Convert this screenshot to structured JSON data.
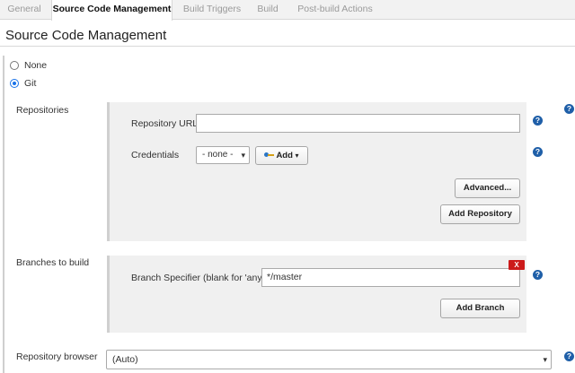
{
  "tabs": [
    {
      "label": "General",
      "active": false
    },
    {
      "label": "Source Code Management",
      "active": true
    },
    {
      "label": "Build Triggers",
      "active": false
    },
    {
      "label": "Build",
      "active": false
    },
    {
      "label": "Post-build Actions",
      "active": false
    }
  ],
  "section": {
    "title": "Source Code Management"
  },
  "scm_options": [
    {
      "label": "None",
      "selected": false
    },
    {
      "label": "Git",
      "selected": true
    }
  ],
  "repositories": {
    "label": "Repositories",
    "url_label": "Repository URL",
    "url_value": "",
    "credentials_label": "Credentials",
    "credentials_value": "- none -",
    "add_label": "Add",
    "advanced_label": "Advanced...",
    "add_repository_label": "Add Repository"
  },
  "branches": {
    "label": "Branches to build",
    "delete_label": "X",
    "specifier_label": "Branch Specifier (blank for 'any')",
    "specifier_value": "*/master",
    "add_branch_label": "Add Branch"
  },
  "repository_browser": {
    "label": "Repository browser",
    "value": "(Auto)"
  },
  "help_glyph": "?",
  "icons": [
    "key-icon",
    "chevron-down-icon",
    "help-icon",
    "delete-icon"
  ],
  "colors": {
    "help": "#1f5fa8",
    "delete": "#cc1b1b",
    "radio_checked": "#1a73e8",
    "panel": "#f0f0f0"
  }
}
